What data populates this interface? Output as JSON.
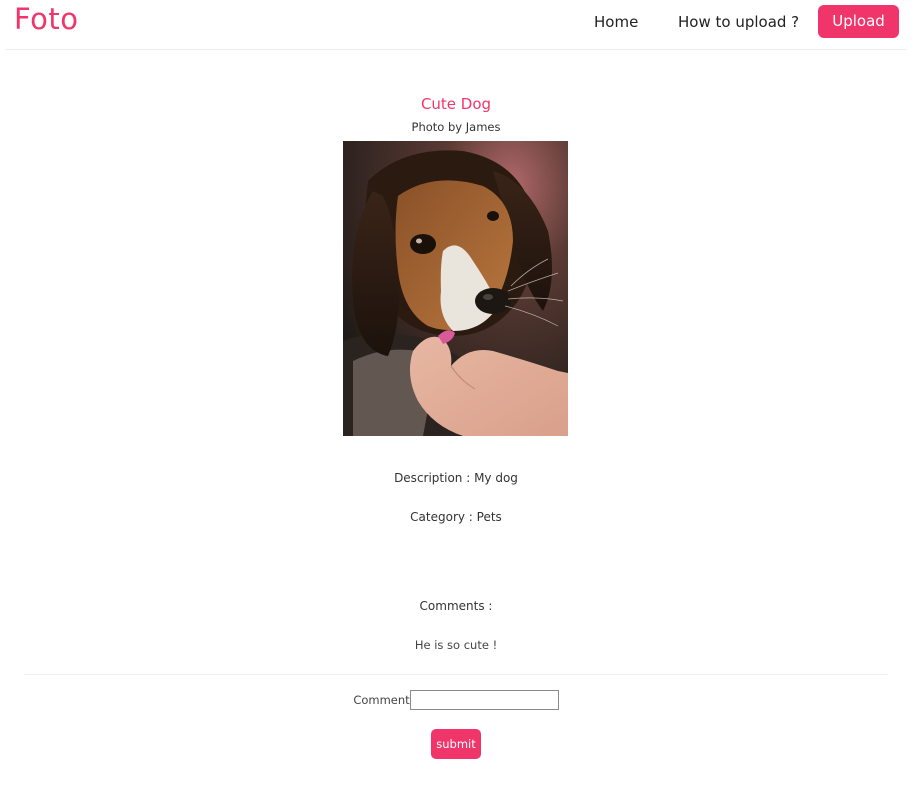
{
  "header": {
    "brand": "Foto",
    "nav": {
      "home": "Home",
      "how_to_upload": "How to upload ?",
      "upload": "Upload"
    }
  },
  "photo": {
    "title": "Cute Dog",
    "byline": "Photo by James",
    "description": "Description : My dog",
    "category": "Category : Pets"
  },
  "comments": {
    "heading": "Comments :",
    "items": [
      "He is so cute !"
    ]
  },
  "comment_form": {
    "label": "Comment",
    "value": "",
    "submit_label": "submit"
  },
  "colors": {
    "accent": "#f0356b"
  }
}
